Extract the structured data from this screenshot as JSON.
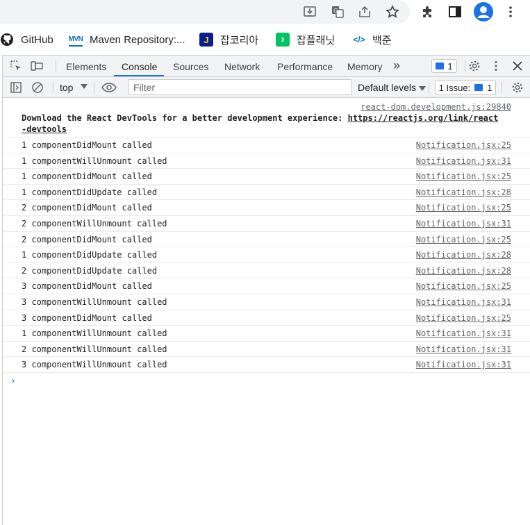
{
  "bookmarks": [
    {
      "label": "GitHub",
      "icon": "github-icon"
    },
    {
      "label": "Maven Repository:...",
      "icon": "maven-icon",
      "badge": "MVN"
    },
    {
      "label": "잡코리아",
      "icon": "jobkorea-icon",
      "badge": "J",
      "color": "#0033cc"
    },
    {
      "label": "잡플래닛",
      "icon": "jobplanet-icon",
      "badge": "›",
      "color": "#00c362"
    },
    {
      "label": "백준",
      "icon": "baekjoon-icon",
      "badge": "</>",
      "color": "#0076c0"
    }
  ],
  "devtools": {
    "tabs": [
      "Elements",
      "Console",
      "Sources",
      "Network",
      "Performance",
      "Memory"
    ],
    "active_tab": "Console",
    "more_tabs_glyph": "»",
    "message_count": "1",
    "context": "top",
    "filter_placeholder": "Filter",
    "levels_label": "Default levels",
    "issues_label": "1 Issue:",
    "issues_count": "1"
  },
  "console": {
    "react_msg": {
      "source": "react-dom.development.js:29840",
      "text": "Download the React DevTools for a better development experience: ",
      "link_part1": "https://reactjs.org/link/react",
      "link_part2": "-devtools"
    },
    "messages": [
      {
        "text": "1 componentDidMount called",
        "source": "Notification.jsx:25"
      },
      {
        "text": "1 componentWillUnmount called",
        "source": "Notification.jsx:31"
      },
      {
        "text": "1 componentDidMount called",
        "source": "Notification.jsx:25"
      },
      {
        "text": "1 componentDidUpdate called",
        "source": "Notification.jsx:28"
      },
      {
        "text": "2 componentDidMount called",
        "source": "Notification.jsx:25"
      },
      {
        "text": "2 componentWillUnmount called",
        "source": "Notification.jsx:31"
      },
      {
        "text": "2 componentDidMount called",
        "source": "Notification.jsx:25"
      },
      {
        "text": "1 componentDidUpdate called",
        "source": "Notification.jsx:28"
      },
      {
        "text": "2 componentDidUpdate called",
        "source": "Notification.jsx:28"
      },
      {
        "text": "3 componentDidMount called",
        "source": "Notification.jsx:25"
      },
      {
        "text": "3 componentWillUnmount called",
        "source": "Notification.jsx:31"
      },
      {
        "text": "3 componentDidMount called",
        "source": "Notification.jsx:25"
      },
      {
        "text": "1 componentWillUnmount called",
        "source": "Notification.jsx:31"
      },
      {
        "text": "2 componentWillUnmount called",
        "source": "Notification.jsx:31"
      },
      {
        "text": "3 componentWillUnmount called",
        "source": "Notification.jsx:31"
      }
    ],
    "prompt_glyph": "›"
  },
  "colors": {
    "accent": "#1a73e8",
    "toolbar_bg": "#f1f3f4",
    "border": "#cbcdd1"
  }
}
